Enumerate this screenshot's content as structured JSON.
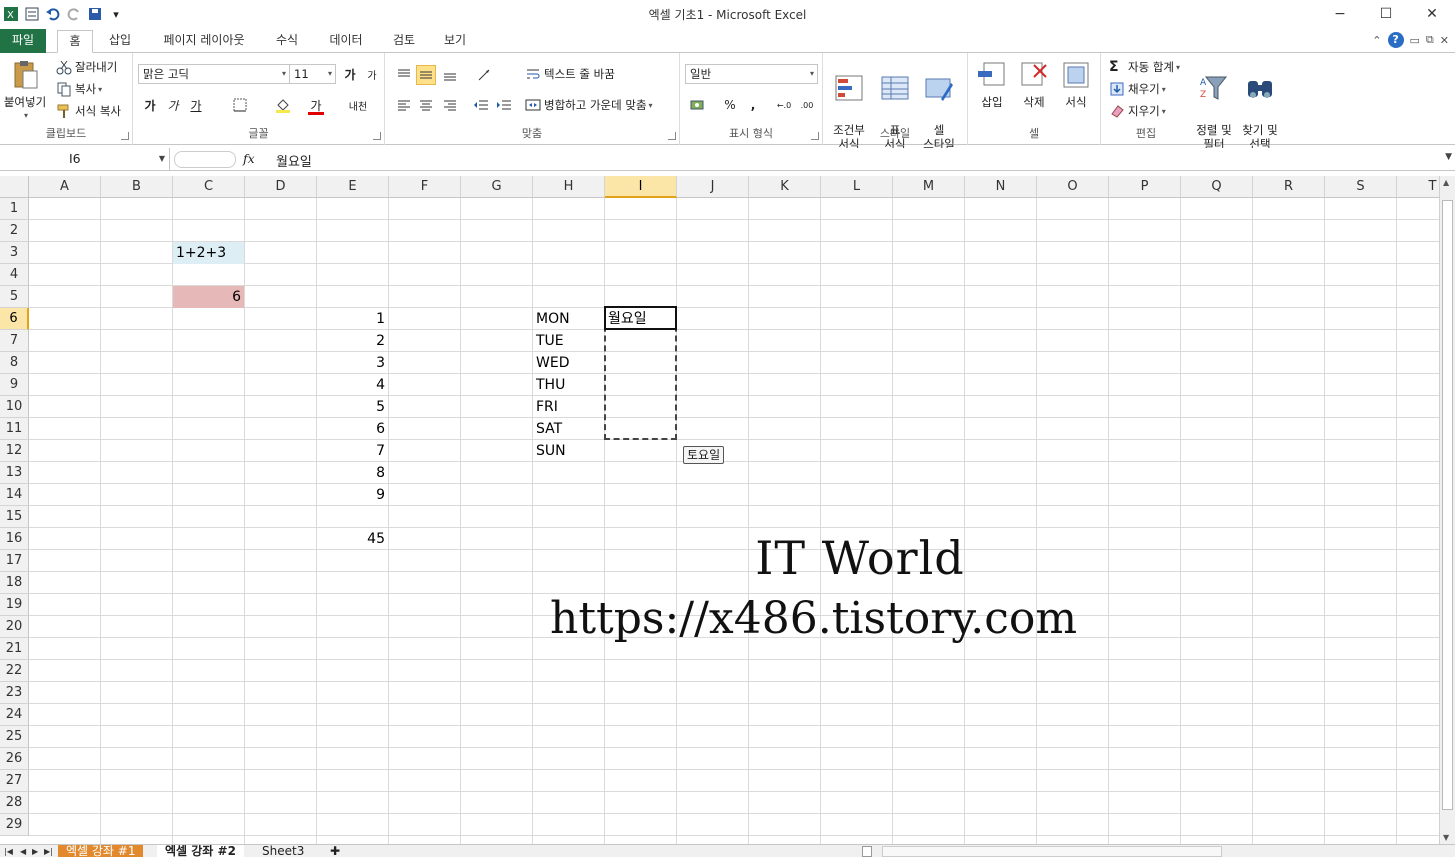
{
  "window": {
    "title": "엑셀 기초1  -  Microsoft Excel",
    "controls": [
      "−",
      "☐",
      "✕"
    ]
  },
  "tabs": {
    "file": "파일",
    "items": [
      "홈",
      "삽입",
      "페이지 레이아웃",
      "수식",
      "데이터",
      "검토",
      "보기"
    ],
    "active": "홈"
  },
  "ribbon": {
    "clipboard": {
      "paste": "붙여넣기",
      "cut": "잘라내기",
      "copy": "복사",
      "format_painter": "서식 복사",
      "label": "클립보드"
    },
    "font": {
      "name": "맑은 고딕",
      "size": "11",
      "grow": "가",
      "shrink": "가",
      "bold": "가",
      "italic": "가",
      "underline": "가",
      "color_a": "가",
      "phonetic": "내천",
      "label": "글꼴"
    },
    "alignment": {
      "wrap": "텍스트 줄 바꿈",
      "merge": "병합하고 가운데 맞춤",
      "label": "맞춤"
    },
    "number": {
      "format": "일반",
      "percent": "%",
      "comma": ",",
      "label": "표시 형식"
    },
    "styles": {
      "conditional": "조건부\n서식",
      "table": "표\n서식",
      "cell": "셀\n스타일",
      "label": "스타일"
    },
    "cells": {
      "insert": "삽입",
      "delete": "삭제",
      "format": "서식",
      "label": "셀"
    },
    "editing": {
      "autosum": "자동 합계",
      "fill": "채우기",
      "clear": "지우기",
      "sort": "정렬 및\n필터",
      "find": "찾기 및\n선택",
      "label": "편집"
    }
  },
  "formula_bar": {
    "name_box": "I6",
    "fx": "fx",
    "content": "월요일"
  },
  "columns": [
    "A",
    "B",
    "C",
    "D",
    "E",
    "F",
    "G",
    "H",
    "I",
    "J",
    "K",
    "L",
    "M",
    "N",
    "O",
    "P",
    "Q",
    "R",
    "S",
    "T"
  ],
  "rows": [
    "1",
    "2",
    "3",
    "4",
    "5",
    "6",
    "7",
    "8",
    "9",
    "10",
    "11",
    "12",
    "13",
    "14",
    "15",
    "16",
    "17",
    "18",
    "19",
    "20",
    "21",
    "22",
    "23",
    "24",
    "25",
    "26",
    "27",
    "28",
    "29"
  ],
  "cells": {
    "C3": "1+2+3",
    "C5": "6",
    "E6": "1",
    "E7": "2",
    "E8": "3",
    "E9": "4",
    "E10": "5",
    "E11": "6",
    "E12": "7",
    "E13": "8",
    "E14": "9",
    "E16": "45",
    "H6": "MON",
    "H7": "TUE",
    "H8": "WED",
    "H9": "THU",
    "H10": "FRI",
    "H11": "SAT",
    "H12": "SUN",
    "I6": "월요일"
  },
  "fill_tooltip": "토요일",
  "watermark": {
    "line1": "IT World",
    "line2": "https://x486.tistory.com"
  },
  "sheets": [
    "엑셀 강좌 #1",
    "엑셀 강좌 #2",
    "Sheet3"
  ],
  "colors": {
    "excel_green": "#217346",
    "c3_fill": "#deeef5",
    "c5_fill": "#e6b8b7",
    "selected_header": "#fbe6a8",
    "sheet_tab_orange": "#e2892e"
  }
}
